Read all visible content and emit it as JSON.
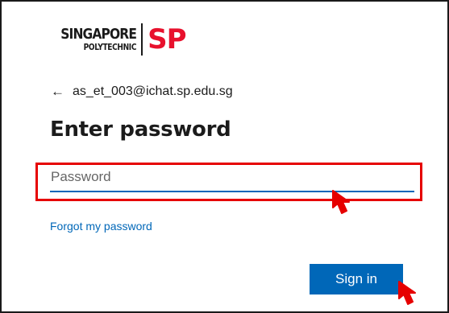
{
  "logo": {
    "word": "SINGAPORE",
    "sub": "POLYTECHNIC",
    "mark": "SP",
    "mark_color": "#e8112d"
  },
  "account": {
    "back_icon": "back-arrow-icon",
    "email": "as_et_003@ichat.sp.edu.sg"
  },
  "page": {
    "title": "Enter password"
  },
  "password_field": {
    "value": "",
    "placeholder": "Password"
  },
  "links": {
    "forgot_password": "Forgot my password"
  },
  "actions": {
    "sign_in_label": "Sign in"
  },
  "annotations": {
    "highlight_color": "#e60000",
    "cursor_icon": "red-cursor-icon"
  },
  "theme": {
    "accent": "#0067b8"
  }
}
